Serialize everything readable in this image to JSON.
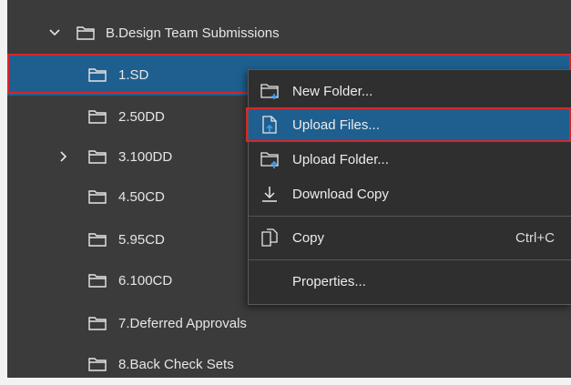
{
  "tree": {
    "parent": {
      "label": "B.Design Team Submissions",
      "expanded": true
    },
    "items": [
      {
        "label": "1.SD",
        "selected": true,
        "has_children": false
      },
      {
        "label": "2.50DD",
        "selected": false,
        "has_children": false
      },
      {
        "label": "3.100DD",
        "selected": false,
        "has_children": true
      },
      {
        "label": "4.50CD",
        "selected": false,
        "has_children": false
      },
      {
        "label": "5.95CD",
        "selected": false,
        "has_children": false
      },
      {
        "label": "6.100CD",
        "selected": false,
        "has_children": false
      },
      {
        "label": "7.Deferred Approvals",
        "selected": false,
        "has_children": false
      },
      {
        "label": "8.Back Check Sets",
        "selected": false,
        "has_children": false
      }
    ]
  },
  "context_menu": {
    "items": [
      {
        "label": "New Folder...",
        "icon": "new-folder-icon",
        "shortcut": ""
      },
      {
        "label": "Upload Files...",
        "icon": "upload-file-icon",
        "shortcut": "",
        "highlighted": true
      },
      {
        "label": "Upload Folder...",
        "icon": "upload-folder-icon",
        "shortcut": ""
      },
      {
        "label": "Download Copy",
        "icon": "download-icon",
        "shortcut": ""
      },
      {
        "label": "Copy",
        "icon": "copy-icon",
        "shortcut": "Ctrl+C"
      },
      {
        "label": "Properties...",
        "icon": "",
        "shortcut": ""
      }
    ]
  },
  "colors": {
    "panel_bg": "#3b3b3b",
    "selection": "#1f5f8f",
    "highlight_outline": "#d8262a",
    "menu_bg": "#2f2f2f",
    "text": "#e6e6e6"
  }
}
